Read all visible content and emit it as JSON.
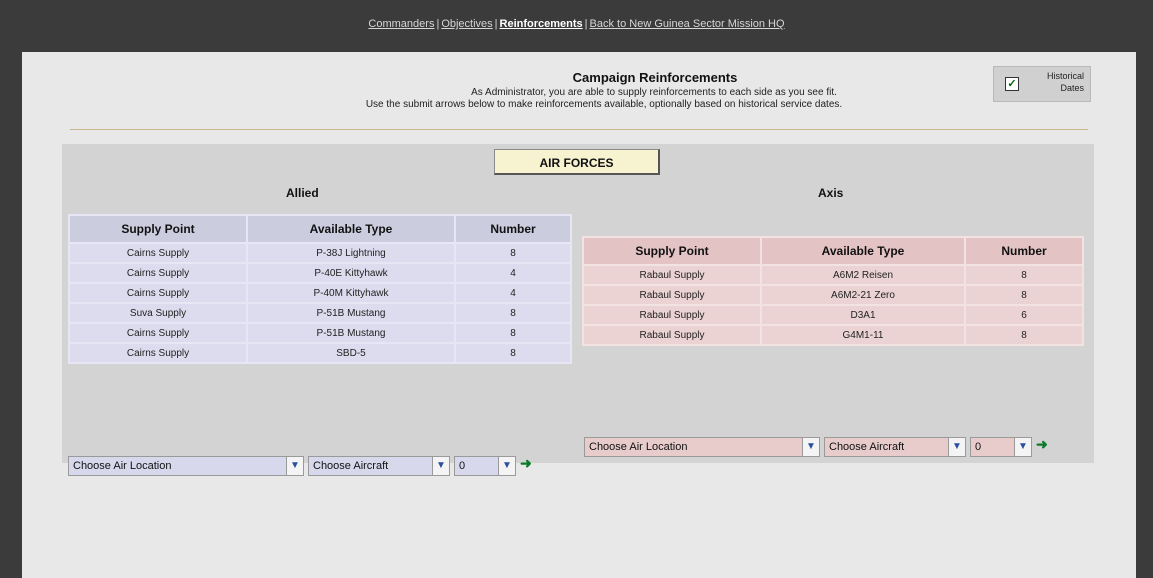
{
  "nav": {
    "commanders": "Commanders",
    "objectives": "Objectives",
    "reinforcements": "Reinforcements",
    "back": "Back to New Guinea Sector Mission HQ",
    "sep": "|"
  },
  "header": {
    "title": "Campaign Reinforcements",
    "line1": "As Administrator, you are able to supply reinforcements to each side as you see fit.",
    "line2": "Use the submit arrows below to make reinforcements available, optionally based on historical service dates."
  },
  "historical": {
    "label": "Historical Dates",
    "checked": true
  },
  "forces_tab": "AIR FORCES",
  "allied": {
    "label": "Allied",
    "columns": [
      "Supply Point",
      "Available Type",
      "Number"
    ],
    "rows": [
      [
        "Cairns Supply",
        "P-38J Lightning",
        "8"
      ],
      [
        "Cairns Supply",
        "P-40E Kittyhawk",
        "4"
      ],
      [
        "Cairns Supply",
        "P-40M Kittyhawk",
        "4"
      ],
      [
        "Suva Supply",
        "P-51B Mustang",
        "8"
      ],
      [
        "Cairns Supply",
        "P-51B Mustang",
        "8"
      ],
      [
        "Cairns Supply",
        "SBD-5",
        "8"
      ]
    ],
    "location_select": "Choose Air Location",
    "aircraft_select": "Choose Aircraft",
    "number_select": "0"
  },
  "axis": {
    "label": "Axis",
    "columns": [
      "Supply Point",
      "Available Type",
      "Number"
    ],
    "rows": [
      [
        "Rabaul Supply",
        "A6M2 Reisen",
        "8"
      ],
      [
        "Rabaul Supply",
        "A6M2-21 Zero",
        "8"
      ],
      [
        "Rabaul Supply",
        "D3A1",
        "6"
      ],
      [
        "Rabaul Supply",
        "G4M1-11",
        "8"
      ]
    ],
    "location_select": "Choose Air Location",
    "aircraft_select": "Choose Aircraft",
    "number_select": "0"
  },
  "colors": {
    "allied_header": "#ccccdf",
    "allied_cell": "#dcdcee",
    "axis_header": "#e3c3c3",
    "axis_cell": "#ecd3d3",
    "submit_arrow": "#0b7a2a"
  },
  "icons": {
    "checkbox": "checkmark-icon",
    "dropdown": "chevron-down-icon",
    "submit": "arrow-right-icon"
  }
}
